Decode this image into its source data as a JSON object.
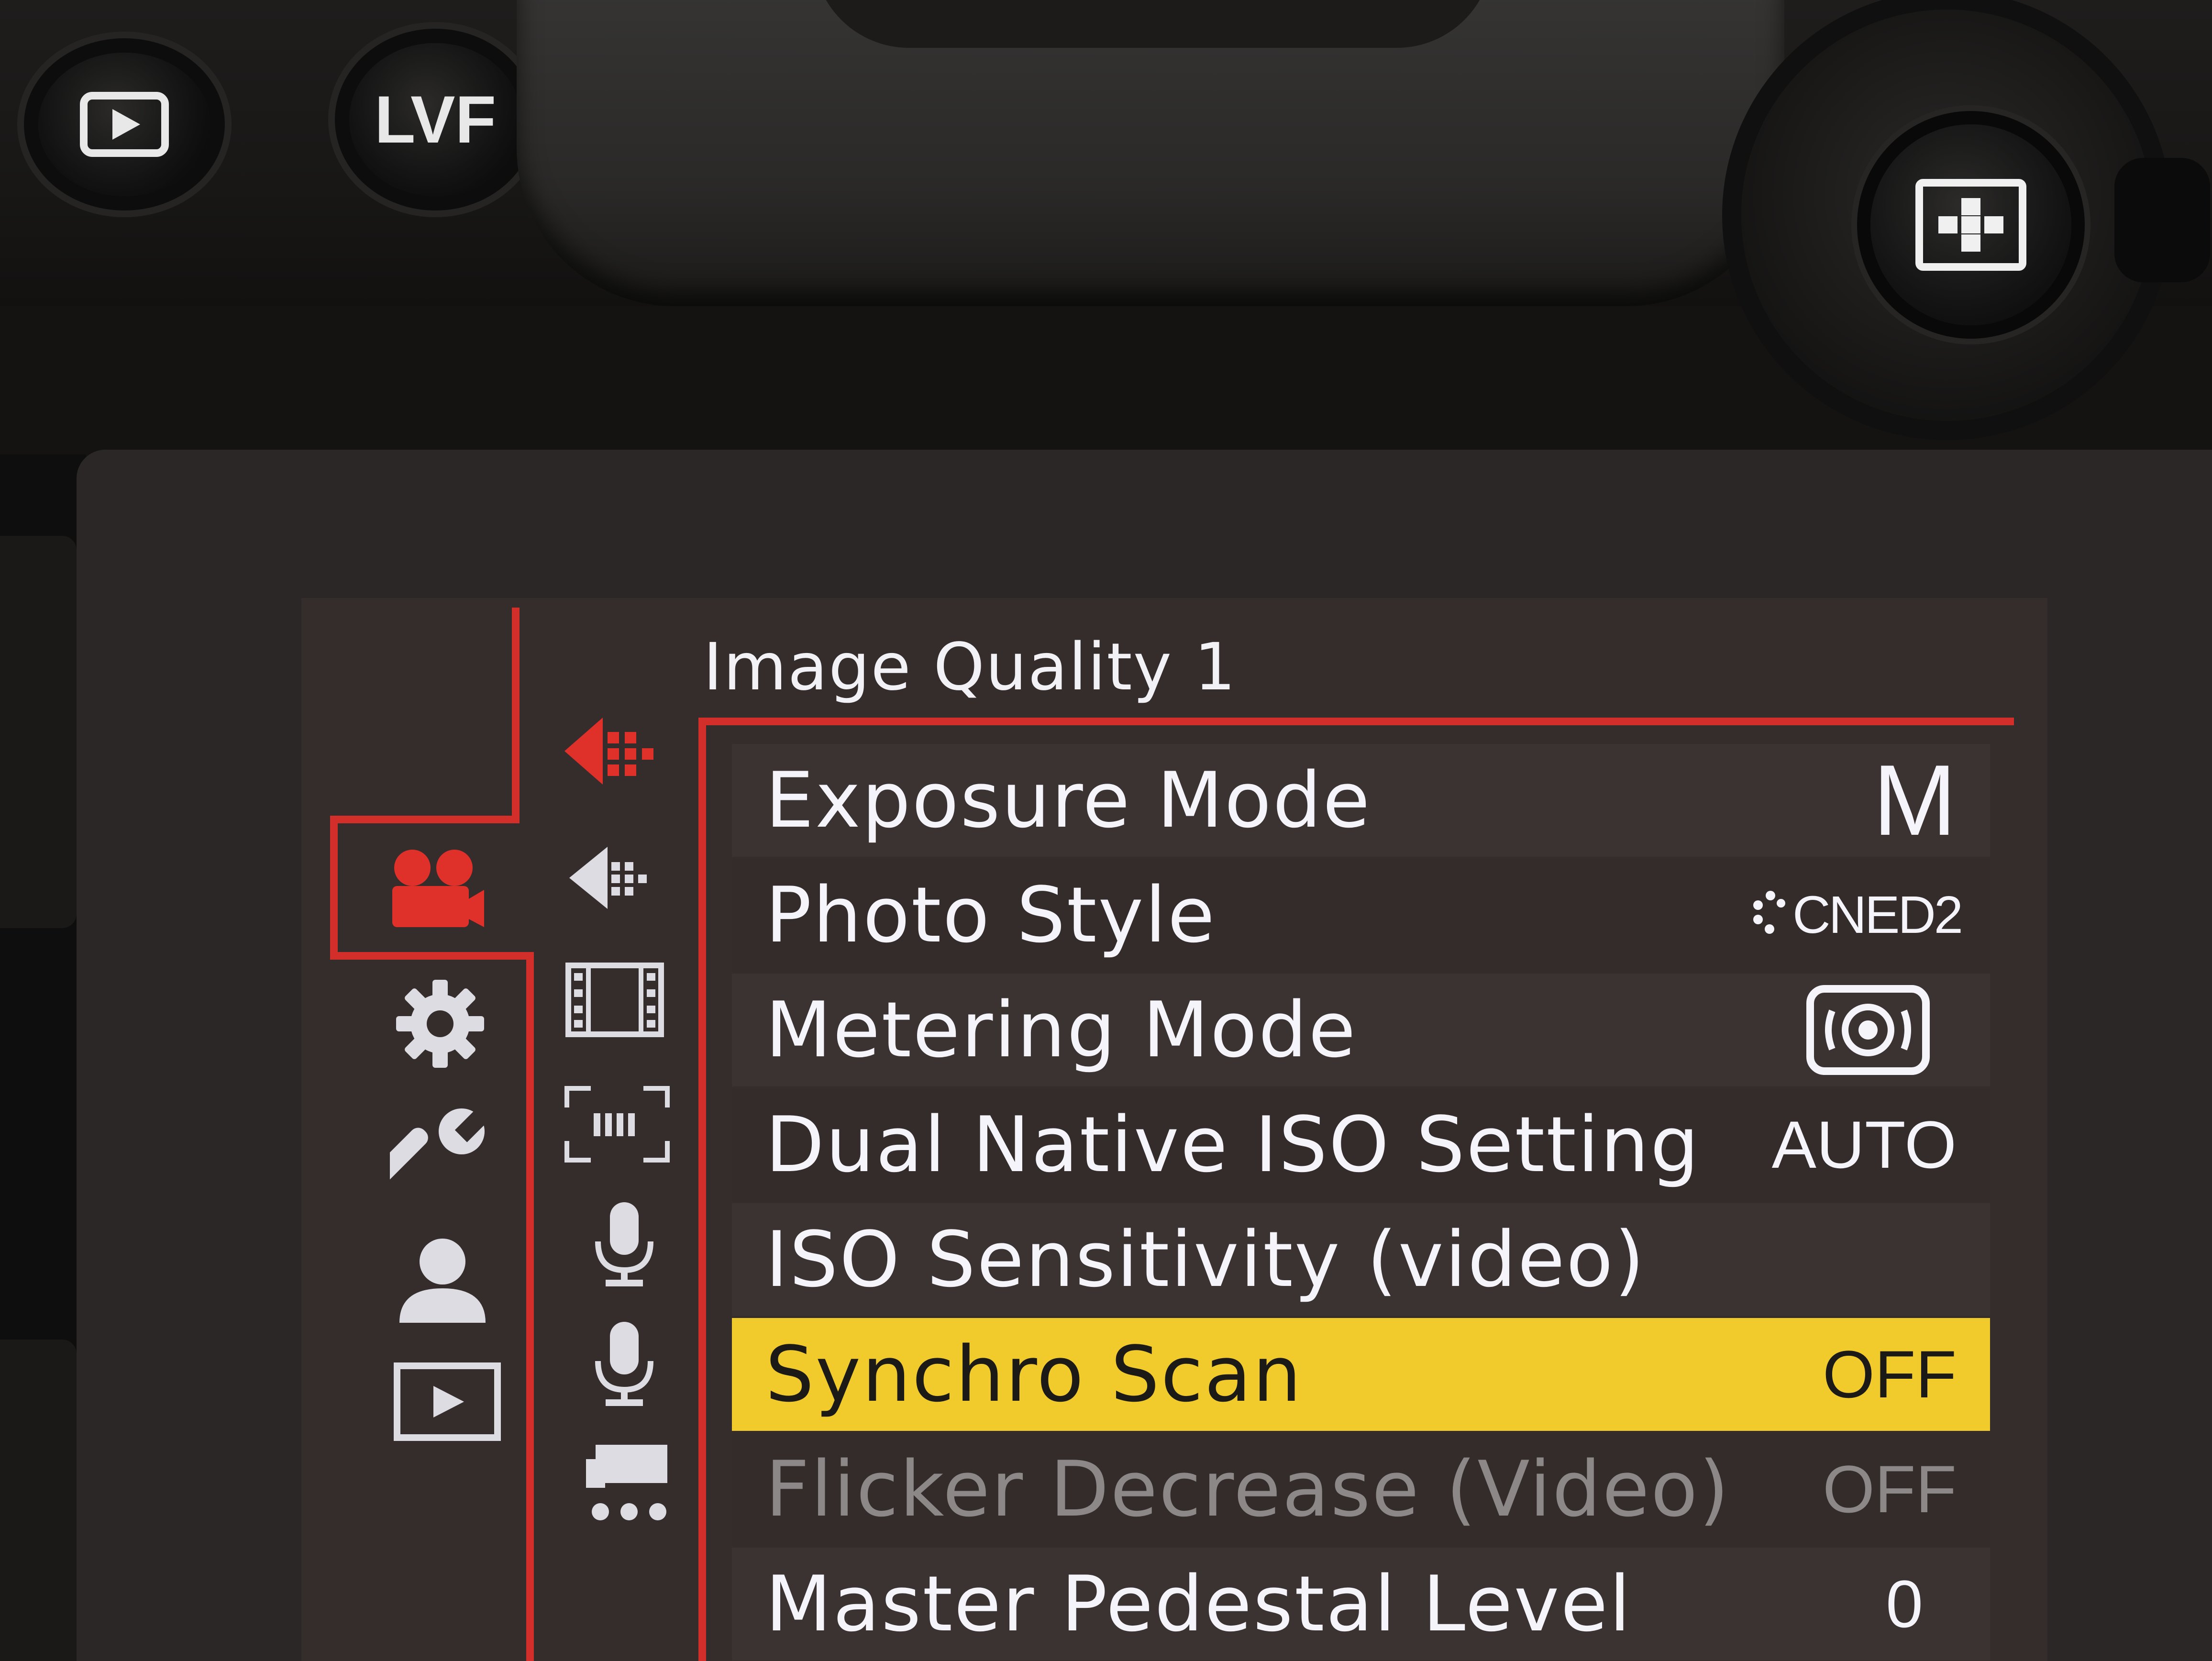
{
  "hardware": {
    "lvf_label": "LVF"
  },
  "menu": {
    "title": "Image Quality 1",
    "categories": [
      {
        "icon": "video-camera-icon",
        "active": true
      },
      {
        "icon": "gear-icon",
        "active": false
      },
      {
        "icon": "wrench-icon",
        "active": false
      },
      {
        "icon": "person-icon",
        "active": false
      },
      {
        "icon": "playback-icon",
        "active": false
      }
    ],
    "subtabs": [
      {
        "icon": "image-quality-1-icon",
        "active": true
      },
      {
        "icon": "image-quality-2-icon",
        "active": false
      },
      {
        "icon": "film-strip-icon",
        "active": false
      },
      {
        "icon": "focus-icon",
        "active": false
      },
      {
        "icon": "microphone-1-icon",
        "active": false
      },
      {
        "icon": "microphone-2-icon",
        "active": false
      },
      {
        "icon": "monitor-display-icon",
        "active": false
      }
    ],
    "items": [
      {
        "label": "Exposure Mode",
        "value": "M"
      },
      {
        "label": "Photo Style",
        "value": "CNED2"
      },
      {
        "label": "Metering Mode",
        "value": ""
      },
      {
        "label": "Dual Native ISO Setting",
        "value": "AUTO"
      },
      {
        "label": "ISO Sensitivity (video)",
        "value": ""
      },
      {
        "label": "Synchro Scan",
        "value": "OFF"
      },
      {
        "label": "Flicker Decrease (Video)",
        "value": "OFF"
      },
      {
        "label": "Master Pedestal Level",
        "value": "0"
      }
    ]
  },
  "colors": {
    "accent_red": "#d32f2a",
    "selected_yellow": "#f1cb2b",
    "text": "#f4f4fa",
    "disabled_text": "#8d8888",
    "menu_bg": "#352d2c"
  }
}
